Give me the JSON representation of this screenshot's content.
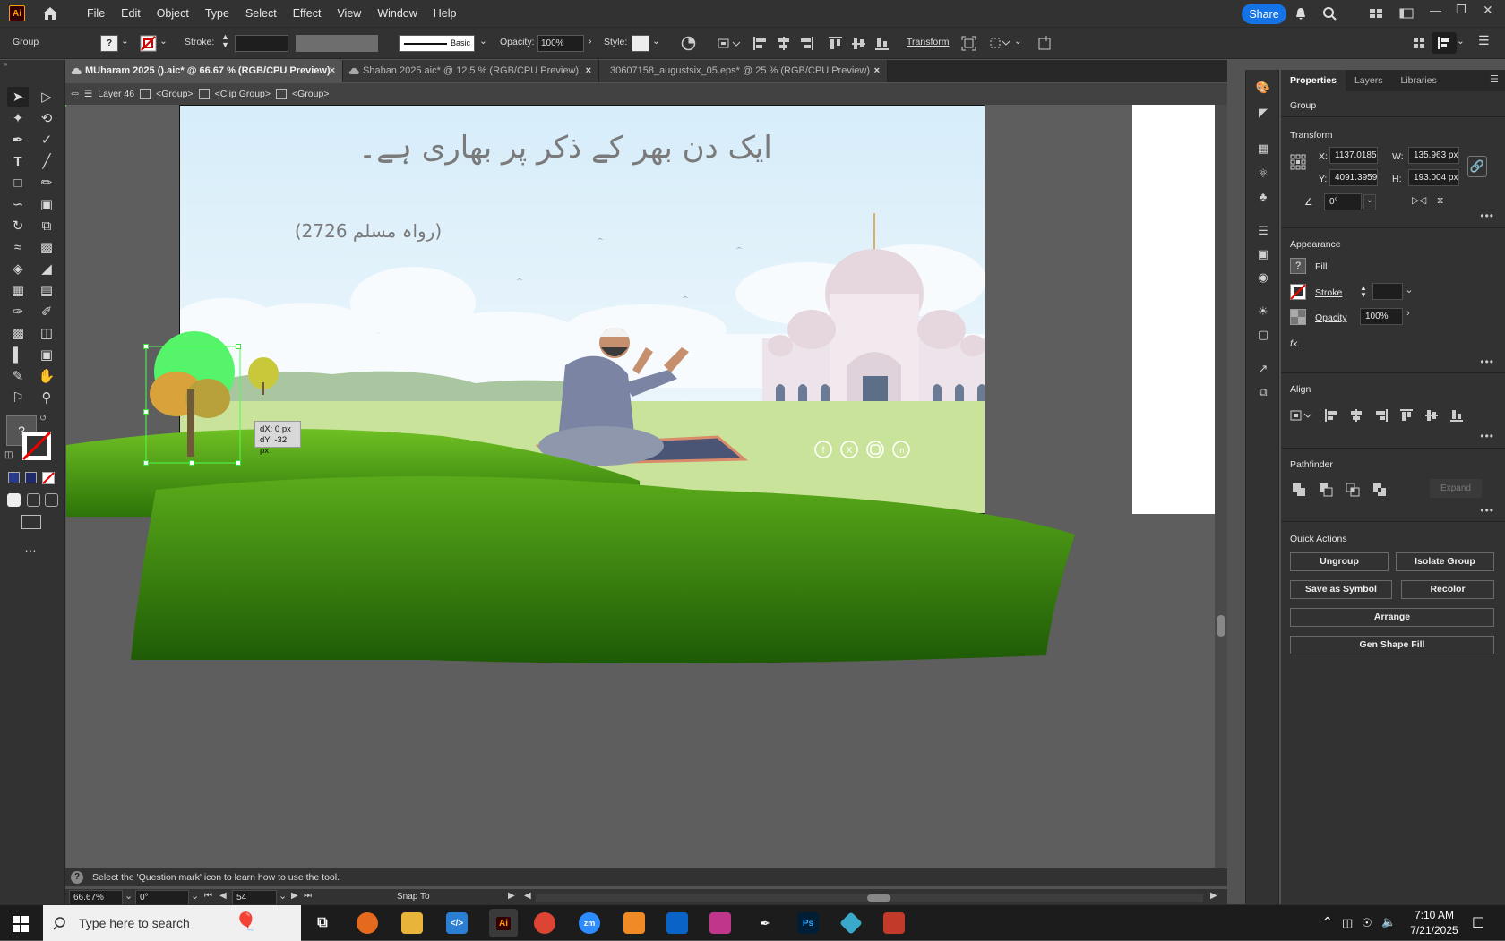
{
  "app": {
    "logo_text": "Ai"
  },
  "menu": [
    "File",
    "Edit",
    "Object",
    "Type",
    "Select",
    "Effect",
    "View",
    "Window",
    "Help"
  ],
  "share_label": "Share",
  "control": {
    "selection_type": "Group",
    "fill_value": "?",
    "stroke_label": "Stroke:",
    "brush_label": "Basic",
    "opacity_label": "Opacity:",
    "opacity_value": "100%",
    "style_label": "Style:",
    "transform_label": "Transform"
  },
  "tabs": [
    {
      "label": "MUharam 2025 ().aic* @ 66.67 % (RGB/CPU Preview)",
      "close": "×"
    },
    {
      "label": "Shaban 2025.aic* @ 12.5 % (RGB/CPU Preview)",
      "close": "×"
    },
    {
      "label": "30607158_augustsix_05.eps* @ 25 % (RGB/CPU Preview)",
      "close": "×"
    }
  ],
  "breadcrumb": [
    "Layer 46",
    "<Group>",
    "<Clip Group>",
    "<Group>"
  ],
  "artboard": {
    "urdu_line1": "ایک دن بھر کے ذکر پر بھاری ہے۔",
    "reference": "(رواہ مسلم 2726)",
    "drag_tooltip": {
      "dx": "dX: 0 px",
      "dy": "dY: -32 px"
    }
  },
  "panel": {
    "tabs": [
      "Properties",
      "Layers",
      "Libraries"
    ],
    "selection": "Group",
    "transform_title": "Transform",
    "x_label": "X:",
    "x_value": "1137.0185",
    "y_label": "Y:",
    "y_value": "4091.3959",
    "w_label": "W:",
    "w_value": "135.963 px",
    "h_label": "H:",
    "h_value": "193.004 px",
    "angle_value": "0°",
    "appearance_title": "Appearance",
    "fill_label": "Fill",
    "stroke_label": "Stroke",
    "opacity_label": "Opacity",
    "opacity_value": "100%",
    "fx_label": "fx.",
    "align_title": "Align",
    "pathfinder_title": "Pathfinder",
    "expand_label": "Expand",
    "quick_actions_title": "Quick Actions",
    "buttons": [
      "Ungroup",
      "Isolate Group",
      "Save as Symbol",
      "Recolor",
      "Arrange",
      "Gen Shape Fill"
    ]
  },
  "status": {
    "hint": "Select the 'Question mark' icon to learn how to use the tool.",
    "zoom": "66.67%",
    "rotation": "0°",
    "artboard_num": "54",
    "snap": "Snap To"
  },
  "taskbar": {
    "search_placeholder": "Type here to search",
    "time": "7:10 AM",
    "date": "7/21/2025"
  },
  "colors": {
    "accent": "#1473e6",
    "selection": "#4cff4c",
    "chrome": "#323232"
  }
}
